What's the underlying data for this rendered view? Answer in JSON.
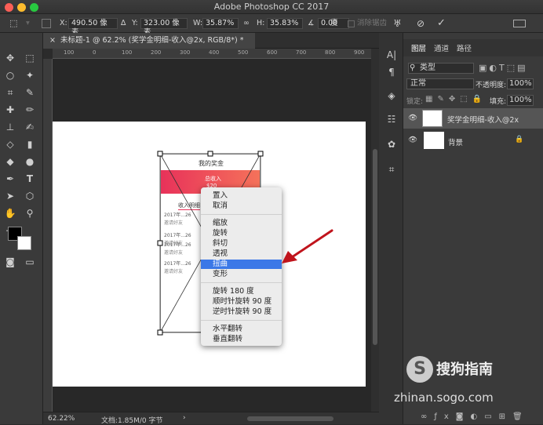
{
  "app": {
    "title": "Adobe Photoshop CC 2017"
  },
  "options_bar": {
    "x_label": "X:",
    "x_value": "490.50 像素",
    "y_label": "Y:",
    "y_value": "323.00 像素",
    "w_label": "W:",
    "w_value": "35.87%",
    "h_label": "H:",
    "h_value": "35.83%",
    "angle_value": "0.00",
    "angle_unit": "度",
    "antialias_label": "消除锯齿"
  },
  "document": {
    "tab_title": "未标题-1 @ 62.2% (奖学金明细-收入@2x, RGB/8*) *"
  },
  "ruler": {
    "h_ticks": [
      "100",
      "0",
      "100",
      "200",
      "300",
      "400",
      "500",
      "600",
      "700",
      "800",
      "900",
      "1000"
    ]
  },
  "phone_mock": {
    "header": "我的奖金",
    "banner_title": "总收入",
    "banner_value": "$20",
    "tab_income": "收入明细",
    "rows": [
      {
        "date": "2017年...26",
        "desc": "邀请好友"
      },
      {
        "date": "2017年...26",
        "desc": "邀请好友"
      },
      {
        "date": "2017年...26",
        "desc": "邀请好友"
      },
      {
        "date": "2017年...26",
        "desc": "邀请好友"
      }
    ]
  },
  "context_menu": {
    "group1": [
      "置入",
      "取消"
    ],
    "group2": [
      "缩放",
      "旋转",
      "斜切",
      "透视",
      "扭曲",
      "变形"
    ],
    "group3": [
      "旋转 180 度",
      "顺时针旋转 90 度",
      "逆时针旋转 90 度"
    ],
    "group4": [
      "水平翻转",
      "垂直翻转"
    ],
    "highlighted": "扭曲",
    "highlight_color": "#3b78e7"
  },
  "status": {
    "zoom": "62.22%",
    "doc_info": "文档:1.85M/0 字节"
  },
  "layers_panel": {
    "tabs": [
      "图层",
      "通道",
      "路径"
    ],
    "filter_label": "类型",
    "blend_mode": "正常",
    "opacity_label": "不透明度:",
    "opacity_value": "100%",
    "lock_label": "锁定:",
    "fill_label": "填充:",
    "fill_value": "100%",
    "layers": [
      {
        "name": "奖学金明细-收入@2x",
        "selected": true
      },
      {
        "name": "背景",
        "selected": false
      }
    ]
  },
  "watermark": {
    "brand": "搜狗指南",
    "url": "zhinan.sogo.com"
  },
  "colors": {
    "arrow": "#c0141c",
    "phone_banner": "#e8325a",
    "accent": "#3b78e7"
  }
}
